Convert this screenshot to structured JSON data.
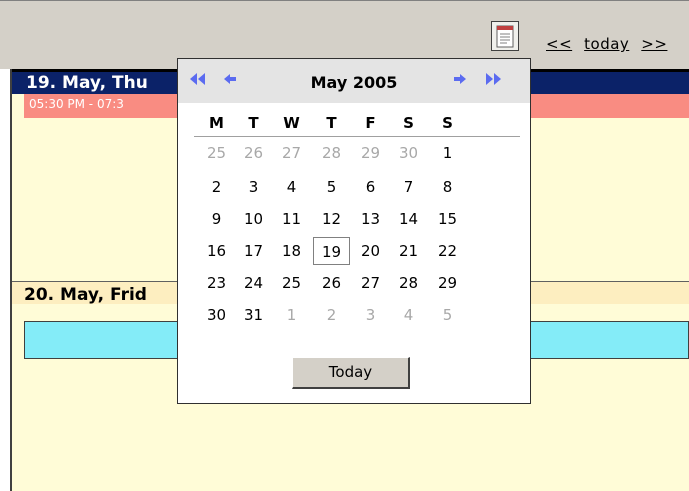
{
  "toolbar": {
    "calendar_button_icon": "calendar-icon",
    "prev_label": "<<",
    "today_label": "today",
    "next_label": ">>"
  },
  "days": [
    {
      "header": "19. May, Thu",
      "event_time": "05:30 PM - 07:3",
      "header_bg": "#0b2268",
      "event_bg": "#f98c82"
    },
    {
      "header": "20. May, Frid",
      "header_bg": "#fdeec0",
      "event_bg": "#84ecf8"
    }
  ],
  "datepicker": {
    "month_title": "May 2005",
    "prev_year_icon": "double-left-arrow-icon",
    "prev_month_icon": "left-arrow-icon",
    "next_month_icon": "right-arrow-icon",
    "next_year_icon": "double-right-arrow-icon",
    "weekdays": [
      "M",
      "T",
      "W",
      "T",
      "F",
      "S",
      "S"
    ],
    "weeks": [
      [
        "25",
        "26",
        "27",
        "28",
        "29",
        "30",
        "1"
      ],
      [
        "2",
        "3",
        "4",
        "5",
        "6",
        "7",
        "8"
      ],
      [
        "9",
        "10",
        "11",
        "12",
        "13",
        "14",
        "15"
      ],
      [
        "16",
        "17",
        "18",
        "19",
        "20",
        "21",
        "22"
      ],
      [
        "23",
        "24",
        "25",
        "26",
        "27",
        "28",
        "29"
      ],
      [
        "30",
        "31",
        "1",
        "2",
        "3",
        "4",
        "5"
      ]
    ],
    "selected_day": "19",
    "today_button": "Today",
    "accent_color": "#5b6bf0"
  }
}
